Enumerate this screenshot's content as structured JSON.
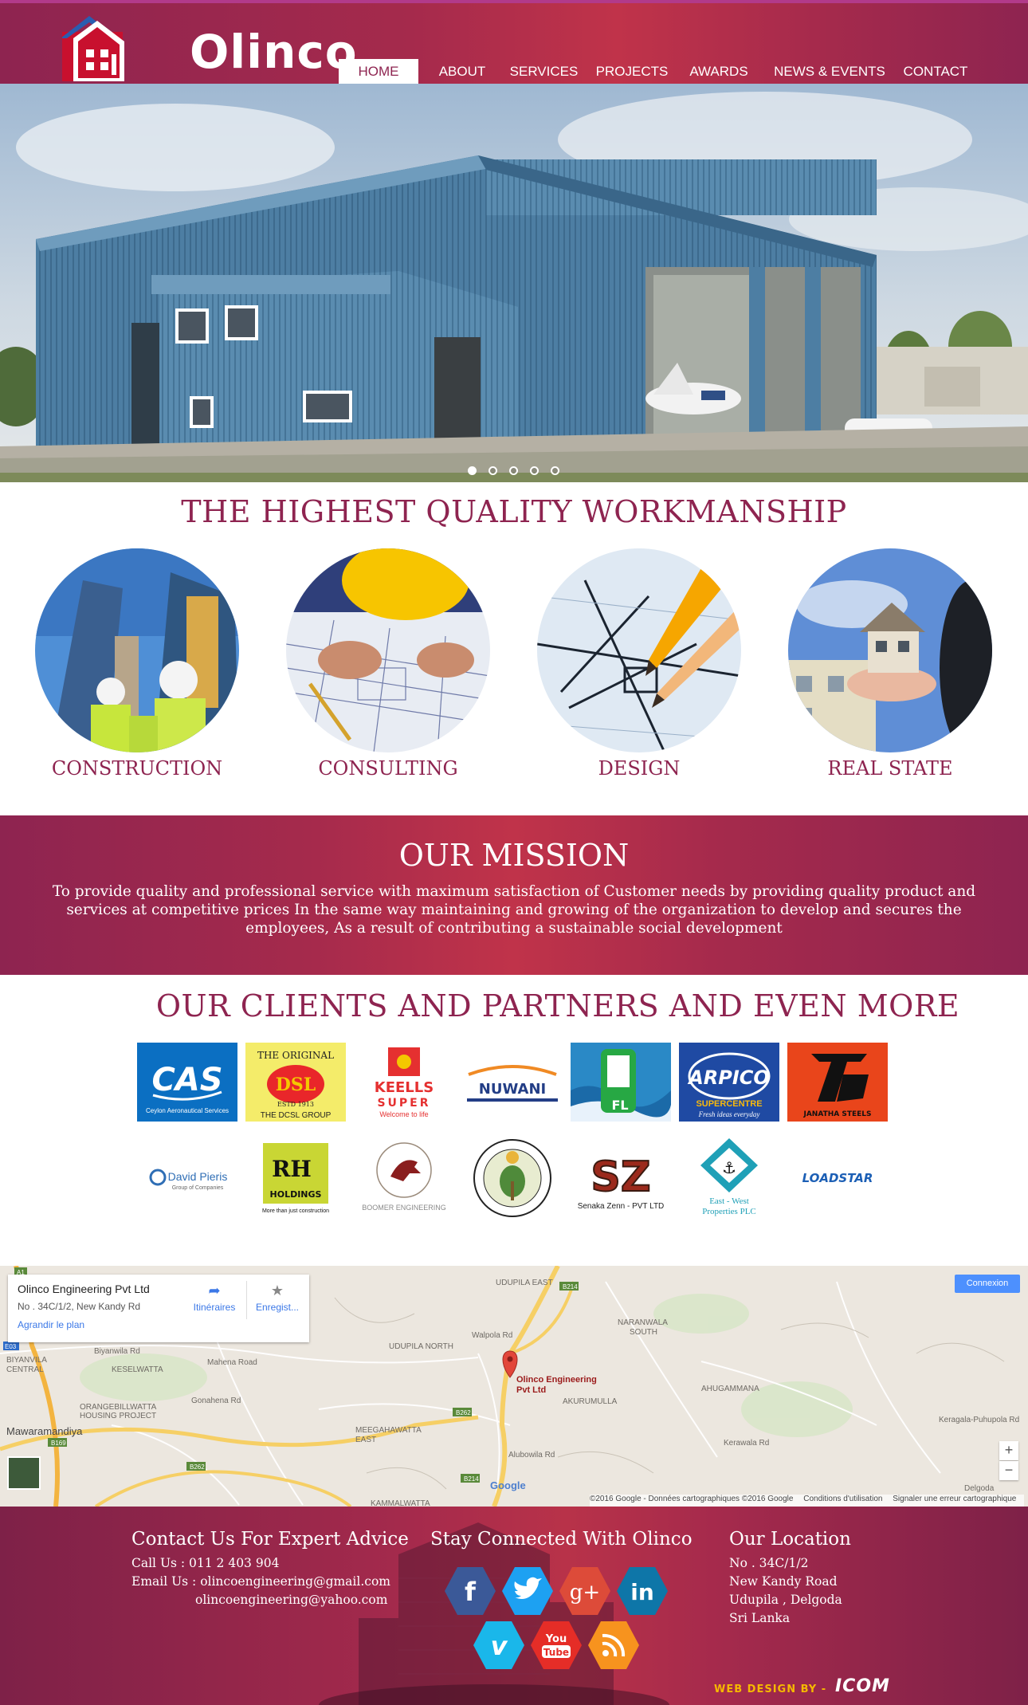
{
  "site": {
    "logo_text": "Olinco"
  },
  "nav": {
    "items": [
      {
        "label": "HOME",
        "active": true
      },
      {
        "label": "ABOUT"
      },
      {
        "label": "SERVICES"
      },
      {
        "label": "PROJECTS"
      },
      {
        "label": "AWARDS"
      },
      {
        "label": "NEWS & EVENTS"
      },
      {
        "label": "CONTACT"
      }
    ]
  },
  "hero": {
    "slide_count": 5,
    "active_slide": 1
  },
  "services": {
    "title": "THE HIGHEST QUALITY WORKMANSHIP",
    "items": [
      {
        "label": "CONSTRUCTION"
      },
      {
        "label": "CONSULTING"
      },
      {
        "label": "DESIGN"
      },
      {
        "label": "REAL STATE"
      }
    ]
  },
  "mission": {
    "title": "OUR MISSION",
    "text": "To provide quality and professional service with maximum satisfaction of Customer needs by providing quality product and services at competitive prices In the same way maintaining and growing of the organization to develop and secures the employees, As a result of contributing a sustainable social development"
  },
  "clients": {
    "title": "OUR CLIENTS AND PARTNERS AND EVEN MORE",
    "logos": {
      "cas": {
        "name": "CAS",
        "sub": "Ceylon Aeronautical Services"
      },
      "dsl": {
        "top": "THE ORIGINAL",
        "name": "DSL",
        "estd": "ESTD 1913",
        "sub": "THE DCSL GROUP"
      },
      "keells": {
        "name": "KEELLS",
        "name2": "SUPER",
        "sub": "Welcome to life"
      },
      "nuwani": {
        "name": "NUWANI"
      },
      "fl": {
        "name": "FL"
      },
      "arpico": {
        "name": "ARPICO",
        "name2": "SUPERCENTRE",
        "sub": "Fresh ideas everyday"
      },
      "janatha": {
        "name": "JANATHA STEELS"
      },
      "davidpieris": {
        "name": "David Pieris",
        "sub": "Group of Companies"
      },
      "rh": {
        "name": "RH",
        "name2": "HOLDINGS",
        "sub": "More than just construction"
      },
      "boomer": {
        "name": "BOOMER ENGINEERING"
      },
      "sz": {
        "name": "SZ",
        "sub": "Senaka Zenn - PVT LTD"
      },
      "eastwest": {
        "name": "East - West",
        "name2": "Properties PLC"
      },
      "loadstar": {
        "name": "LOADSTAR"
      }
    }
  },
  "map": {
    "place_name": "Olinco Engineering Pvt Ltd",
    "address": "No . 34C/1/2, New Kandy Rd",
    "enlarge": "Agrandir le plan",
    "directions": "Itinéraires",
    "save": "Enregist...",
    "signin": "Connexion",
    "marker_label_1": "Olinco Engineering",
    "marker_label_2": "Pvt Ltd",
    "places": {
      "udupila_east": "UDUPILA EAST",
      "naranwala": "NARANWALA",
      "south": "SOUTH",
      "biyanvila": "BIYANVILA",
      "central": "CENTRAL",
      "keselwatta": "KESELWATTA",
      "udupila_north": "UDUPILA NORTH",
      "ahugammana": "AHUGAMMANA",
      "akurumulla": "AKURUMULLA",
      "orangebillwatta": "ORANGEBILLWATTA",
      "housing_project": "HOUSING PROJECT",
      "mawaramandiya": "Mawaramandiya",
      "meegahawatta": "MEEGAHAWATTA",
      "east": "EAST",
      "kammalwatta": "KAMMALWATTA",
      "delgoda": "Delgoda",
      "b214": "B214",
      "b262": "B262",
      "b169": "B169",
      "e03": "E03",
      "a1": "A1",
      "mahena_rd": "Mahena Road",
      "alubowila_rd": "Alubowila Rd",
      "kerawala_rd": "Kerawala Rd",
      "gonahena_rd": "Gonahena Rd",
      "biyanwila_rd": "Biyanwila Rd",
      "walpola_rd": "Walpola Rd",
      "keragala_rd": "Keragala-Puhupola Rd",
      "google": "Google"
    },
    "footer": {
      "copyright": "©2016 Google - Données cartographiques ©2016 Google",
      "terms": "Conditions d'utilisation",
      "report": "Signaler une erreur cartographique"
    }
  },
  "footer": {
    "contact": {
      "title": "Contact Us For Expert Advice",
      "call": "Call Us : 011 2 403 904",
      "email1": "Email Us : olincoengineering@gmail.com",
      "email2": "olincoengineering@yahoo.com"
    },
    "social": {
      "title": "Stay Connected With Olinco",
      "networks": [
        "facebook",
        "twitter",
        "google-plus",
        "linkedin",
        "vimeo",
        "youtube",
        "rss"
      ],
      "gplus_label": "g+",
      "linkedin_label": "in",
      "vimeo_label": "v",
      "youtube_label_1": "You",
      "youtube_label_2": "Tube",
      "facebook_label": "f"
    },
    "location": {
      "title": "Our Location",
      "line1": "No . 34C/1/2",
      "line2": "New Kandy Road",
      "line3": "Udupila , Delgoda",
      "line4": "Sri Lanka"
    },
    "credit": "WEB DESIGN BY - ",
    "credit_brand": "ICOM"
  },
  "colors": {
    "brand": "#8e2450",
    "brand_light": "#c0334a",
    "facebook": "#3b5998",
    "twitter": "#1da1f2",
    "gplus": "#dd4b39",
    "linkedin": "#0e76a8",
    "vimeo": "#1ab7ea",
    "youtube": "#e52d27",
    "rss": "#f7931e"
  }
}
